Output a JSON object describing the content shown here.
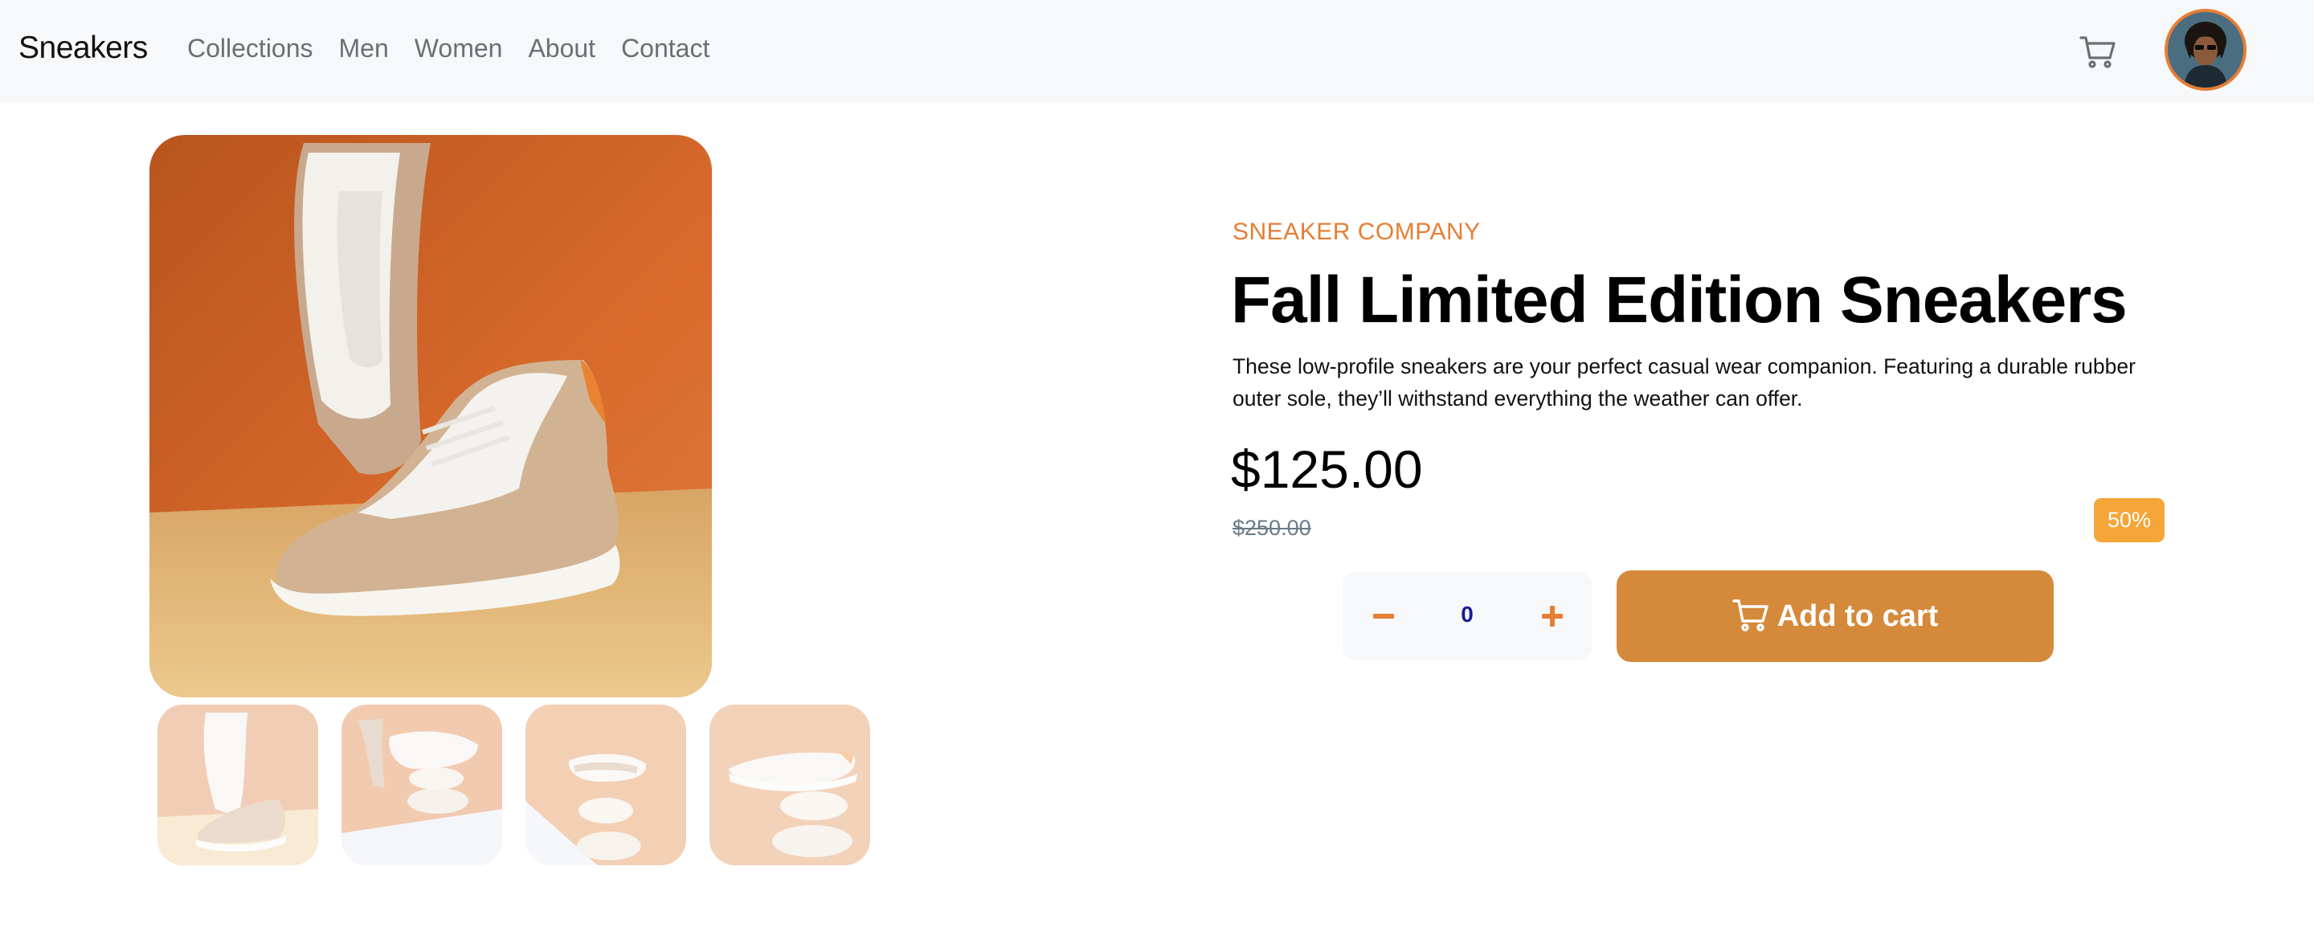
{
  "header": {
    "brand": "Sneakers",
    "nav": [
      "Collections",
      "Men",
      "Women",
      "About",
      "Contact"
    ],
    "cart_icon": "cart-icon",
    "avatar": "user-avatar"
  },
  "gallery": {
    "main_image": "sneaker-main-photo",
    "thumbnails": [
      "thumbnail-1",
      "thumbnail-2",
      "thumbnail-3",
      "thumbnail-4"
    ]
  },
  "product": {
    "company": "SNEAKER COMPANY",
    "title": "Fall Limited Edition Sneakers",
    "description": "These low-profile sneakers are your perfect casual wear companion. Featuring a durable rubber outer sole, they’ll withstand everything the weather can offer.",
    "price": "$125.00",
    "old_price": "$250.00",
    "discount": "50%"
  },
  "cart": {
    "quantity": "0",
    "minus_icon": "minus-icon",
    "plus_icon": "plus-icon",
    "add_label": "Add to cart"
  },
  "colors": {
    "accent": "#e67e34",
    "button": "#d5893b",
    "badge": "#f5a638",
    "nav_bg": "#f7f8fa"
  }
}
